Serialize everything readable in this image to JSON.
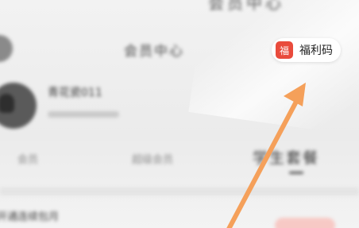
{
  "header": {
    "top_text": "会员中心",
    "title": "会员中心"
  },
  "user": {
    "name": "青花瓷011"
  },
  "tabs": [
    {
      "label": "会员"
    },
    {
      "label": "超级会员"
    },
    {
      "label": "学生套餐"
    }
  ],
  "promo_button": {
    "icon_char": "福",
    "label": "福利码"
  },
  "list": {
    "first_item": "开通连续包月"
  },
  "colors": {
    "arrow": "#f5a05a",
    "badge_icon": "#e94b3c"
  },
  "icons": {
    "badge_icon": "fu-icon",
    "annotation": "orange-arrow-icon"
  }
}
